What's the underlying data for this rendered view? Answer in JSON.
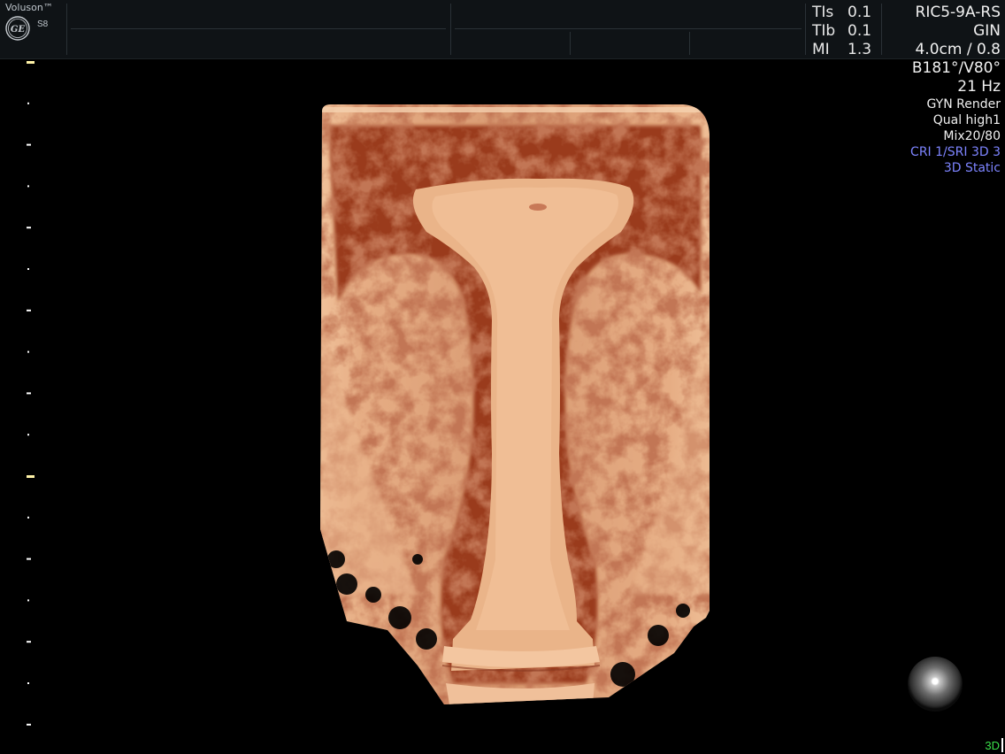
{
  "header": {
    "brand": "Voluson™",
    "model": "S8",
    "logo": "GE"
  },
  "params": [
    {
      "key": "TIs",
      "value": "0.1"
    },
    {
      "key": "TIb",
      "value": "0.1"
    },
    {
      "key": "MI",
      "value": "1.3"
    }
  ],
  "info": {
    "probe": "RIC5-9A-RS",
    "preset": "GIN",
    "depth": "4.0cm / 0.8",
    "angle": "B181°/V80°",
    "frequency": "21 Hz",
    "render": "GYN Render",
    "quality": "Qual high1",
    "mix": "Mix20/80",
    "cri_sri": "CRI 1/SRI 3D 3",
    "mode": "3D Static"
  },
  "footer": {
    "mode_label": "3D"
  },
  "colors": {
    "tissue_light": "#e9b48a",
    "tissue_dark": "#8a2e17",
    "info_blue": "#7d84ff",
    "mode_green": "#3be04a",
    "depth_tick": "#fff3a8"
  },
  "icons": [
    "ge-logo-icon",
    "light-source-icon"
  ]
}
